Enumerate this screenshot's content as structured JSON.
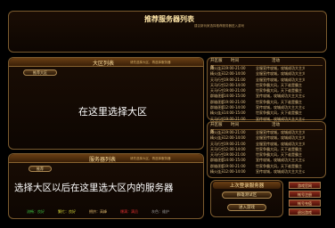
{
  "top": {
    "title": "推荐服务器列表",
    "subtitle": "建议新玩家选择推荐服务器进入游戏"
  },
  "region_panel": {
    "title": "大区列表",
    "subtitle": "请先选择大区，再选择服务器",
    "tag": "推荐大区",
    "placeholder": "在这里选择大区"
  },
  "server_panel": {
    "title": "服务器列表",
    "subtitle": "请先选择大区，再选择服务器",
    "tag": "推荐",
    "placeholder": "选择大区以后在这里选大区内的服务器"
  },
  "legend": [
    {
      "label": "流畅：良好",
      "color": "#3fbf3f"
    },
    {
      "label": "繁忙：良好",
      "color": "#d8d83a"
    },
    {
      "label": "拥挤：高峰",
      "color": "#d8b26a"
    },
    {
      "label": "爆满：满员",
      "color": "#e03030"
    },
    {
      "label": "灰色：维护",
      "color": "#9a9a9a"
    }
  ],
  "list1": {
    "header": [
      "开区服务",
      "时间",
      "活动"
    ],
    "rows": [
      [
        "精火连天",
        "19:00-21:00",
        "全服宣传攻城，攻城成功大主大主公"
      ],
      [
        "精火连天",
        "12:00-14:00",
        "全服宣传攻城，攻城成功大主大主公"
      ],
      [
        "天马行空",
        "19:00-21:00",
        "全服宣传攻城，攻城成功大主大主公"
      ],
      [
        "天马行空",
        "12:00-14:00",
        "世家争霸大风，天下谁是霸主"
      ],
      [
        "天马行空",
        "19:00-21:00",
        "世家争霸大风，天下谁是霸主"
      ],
      [
        "群雄逐鹿",
        "14:00-15:00",
        "宣传攻城，攻城成功大主大主公"
      ],
      [
        "群雄逐鹿",
        "19:00-21:00",
        "世家争霸大风，天下谁是霸主"
      ],
      [
        "群雄逐鹿",
        "12:00-14:00",
        "宣传攻城，攻城成功大主大主公"
      ],
      [
        "精火连天",
        "14:00-15:00",
        "世家争霸大风，天下谁是霸主"
      ],
      [
        "天马行空",
        "19:00-21:00",
        "宣传攻城，攻城成功大主大主公"
      ]
    ]
  },
  "list2": {
    "header": [
      "开区服务",
      "时间",
      "活动"
    ],
    "rows": [
      [
        "精火连天",
        "19:00-21:00",
        "全服宣传攻城，攻城成功大主大主公"
      ],
      [
        "精火连天",
        "12:00-14:00",
        "全服宣传攻城，攻城成功大主大主公"
      ],
      [
        "天马行空",
        "19:00-21:00",
        "全服宣传攻城，攻城成功大主大主公"
      ],
      [
        "天马行空",
        "12:00-14:00",
        "世家争霸大风，天下谁是霸主"
      ],
      [
        "天马行空",
        "19:00-21:00",
        "世家争霸大风，天下谁是霸主"
      ],
      [
        "群雄逐鹿",
        "14:00-15:00",
        "宣传攻城，攻城成功大主大主公"
      ],
      [
        "群雄逐鹿",
        "19:00-21:00",
        "世家争霸大风，天下谁是霸主"
      ],
      [
        "精火连天",
        "12:00-14:00",
        "宣传攻城，攻城成功大主大主公"
      ]
    ]
  },
  "last_server": {
    "title": "上次登录服务器",
    "server": "群雄测试区",
    "button": "进入游戏"
  },
  "side_buttons": [
    "游戏官网",
    "帐号注册",
    "帐号充值",
    "退出游戏"
  ]
}
